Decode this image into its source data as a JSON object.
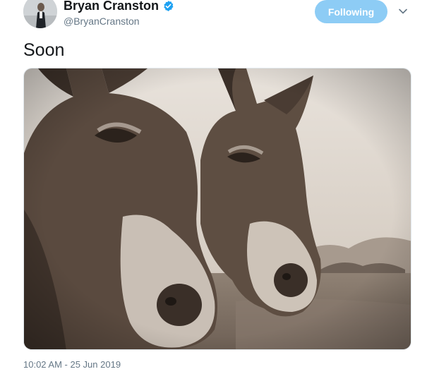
{
  "author": {
    "display_name": "Bryan Cranston",
    "handle": "@BryanCranston",
    "verified": true
  },
  "follow_button": {
    "label": "Following"
  },
  "tweet": {
    "text": "Soon",
    "timestamp": "10:02 AM - 25 Jun 2019"
  },
  "media": {
    "alt": "Photo of two donkeys"
  },
  "icons": {
    "verified": "verified-badge-icon",
    "menu": "chevron-down-icon"
  },
  "colors": {
    "follow_bg": "#8dccf5",
    "verified": "#1da1f2",
    "secondary_text": "#657786"
  }
}
